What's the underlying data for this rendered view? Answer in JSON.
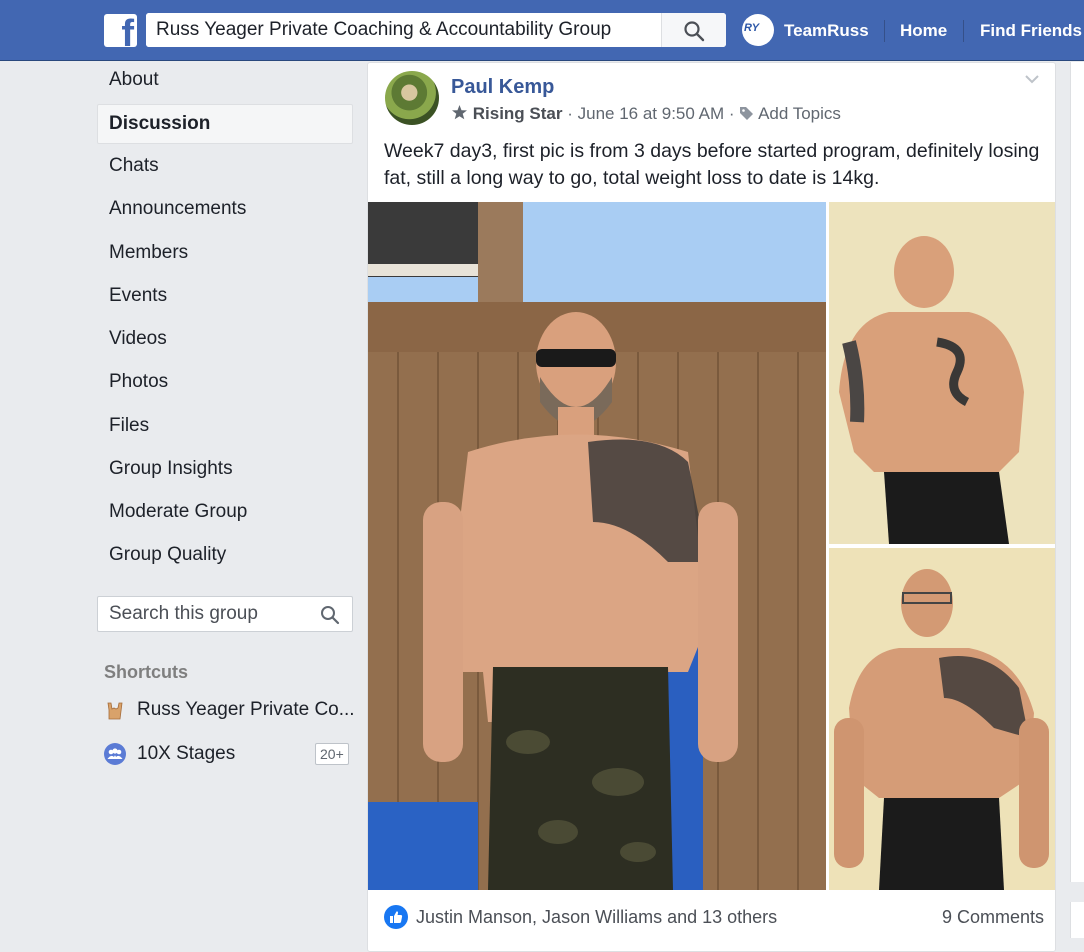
{
  "topbar": {
    "logo": "f",
    "search_value": "Russ Yeager Private Coaching & Accountability Group",
    "profile_avatar_text": "RY",
    "profile_name": "TeamRuss",
    "home_label": "Home",
    "find_friends_label": "Find Friends"
  },
  "sidebar": {
    "items": [
      {
        "label": "About"
      },
      {
        "label": "Discussion"
      },
      {
        "label": "Chats"
      },
      {
        "label": "Announcements"
      },
      {
        "label": "Members"
      },
      {
        "label": "Events"
      },
      {
        "label": "Videos"
      },
      {
        "label": "Photos"
      },
      {
        "label": "Files"
      },
      {
        "label": "Group Insights"
      },
      {
        "label": "Moderate Group"
      },
      {
        "label": "Group Quality"
      }
    ],
    "active_item": "Discussion",
    "search_placeholder": "Search this group",
    "shortcuts_title": "Shortcuts",
    "shortcuts": [
      {
        "label": "Russ Yeager Private Co...",
        "icon": "rock-hand-icon"
      },
      {
        "label": "10X Stages",
        "icon": "group-icon",
        "badge": "20+"
      }
    ]
  },
  "post": {
    "author": "Paul Kemp",
    "badge": "Rising Star",
    "separator": "·",
    "timestamp": "June 16 at 9:50 AM",
    "add_topics": "Add Topics",
    "text": "Week7 day3, first pic is from 3 days before started program, definitely losing fat, still a long way to go, total weight loss to date is 14kg.",
    "reactions_text": "Justin Manson, Jason Williams and 13 others",
    "comments_text": "9 Comments"
  },
  "colors": {
    "brand_blue": "#4267b2",
    "link_blue": "#385898",
    "background": "#e9ebee",
    "like_blue": "#1877f2"
  }
}
